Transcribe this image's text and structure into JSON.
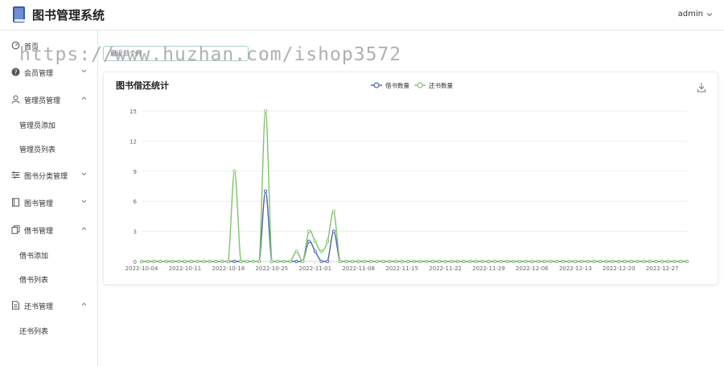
{
  "header": {
    "app_title": "图书管理系统",
    "user_name": "admin"
  },
  "watermark": "https://www.huzhan.com/ishop3572",
  "sidebar": {
    "home": "首页",
    "member": "会员管理",
    "admin": "管理员管理",
    "admin_add": "管理员添加",
    "admin_list": "管理员列表",
    "category": "图书分类管理",
    "book": "图书管理",
    "borrow": "借书管理",
    "borrow_add": "借书添加",
    "borrow_list": "借书列表",
    "return": "还书管理",
    "return_list": "还书列表"
  },
  "filter": {
    "range_value": "最近三个月"
  },
  "colors": {
    "borrow": "#4a64a8",
    "return": "#7fc26b",
    "grid": "#e9e9e9",
    "axis": "#666666"
  },
  "chart_data": {
    "type": "line",
    "title": "图书借还统计",
    "smooth": true,
    "legend_position": "top-center",
    "ylim": [
      0,
      15
    ],
    "yticks": [
      0,
      3,
      6,
      9,
      12,
      15
    ],
    "x_start": "2022-10-04",
    "x_end": "2022-12-31",
    "xtick_labels": [
      "2022-10-04",
      "2022-10-11",
      "2022-10-18",
      "2022-10-25",
      "2022-11-01",
      "2022-11-08",
      "2022-11-15",
      "2022-11-22",
      "2022-11-29",
      "2022-12-06",
      "2022-12-13",
      "2022-12-20",
      "2022-12-27"
    ],
    "series": [
      {
        "name": "借书数量",
        "points": [
          [
            "2022-10-24",
            7
          ],
          [
            "2022-10-31",
            2
          ],
          [
            "2022-11-01",
            1
          ],
          [
            "2022-11-04",
            3
          ]
        ]
      },
      {
        "name": "还书数量",
        "points": [
          [
            "2022-10-19",
            9
          ],
          [
            "2022-10-24",
            15
          ],
          [
            "2022-10-29",
            1
          ],
          [
            "2022-10-31",
            3
          ],
          [
            "2022-11-01",
            2
          ],
          [
            "2022-11-02",
            1
          ],
          [
            "2022-11-03",
            2
          ],
          [
            "2022-11-04",
            5
          ]
        ]
      }
    ]
  }
}
